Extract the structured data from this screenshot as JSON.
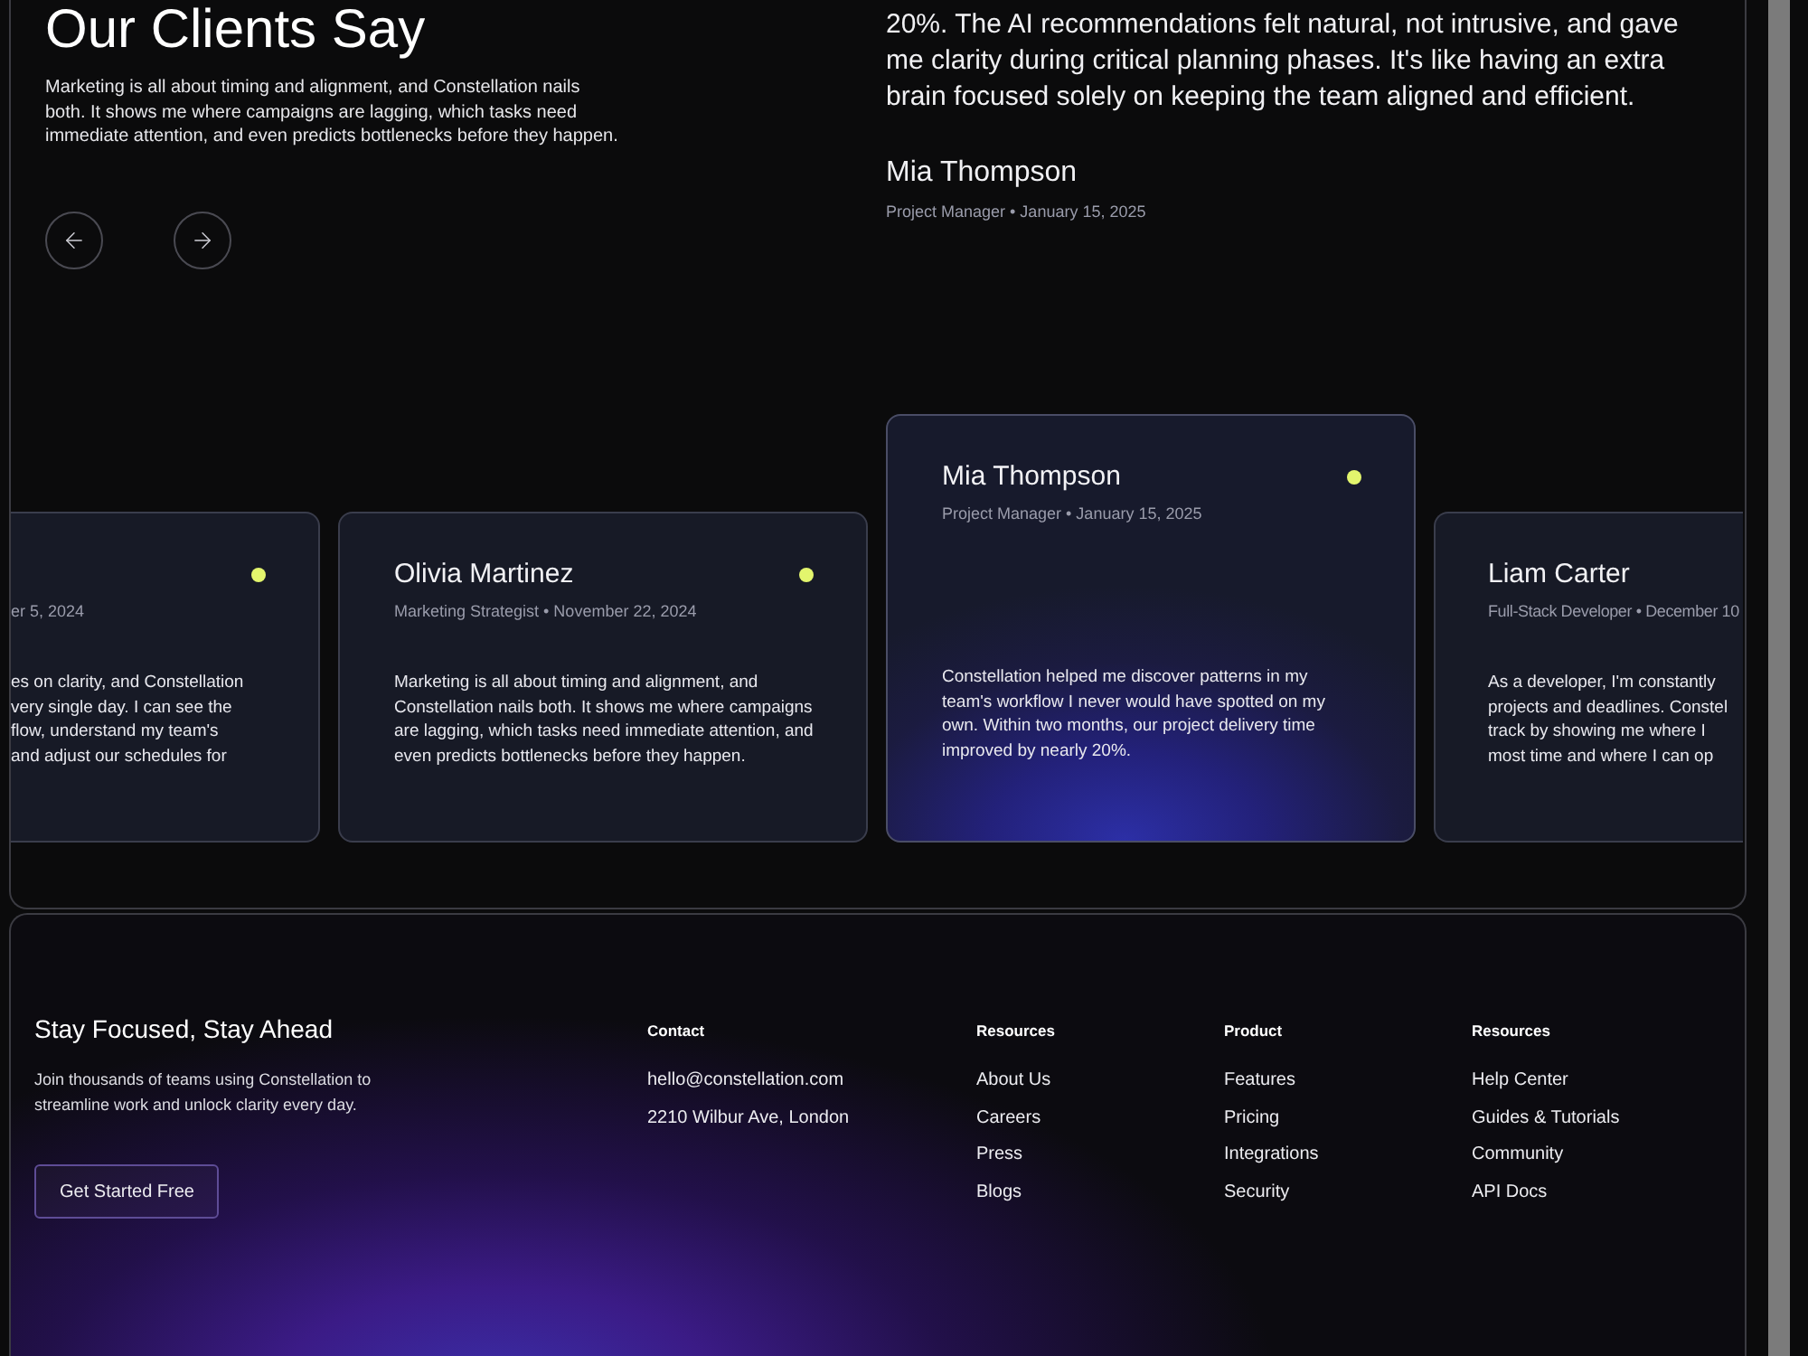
{
  "testimonials": {
    "heading": "Our Clients Say",
    "intro": "Marketing is all about timing and alignment, and Constellation nails both. It shows me where campaigns are lagging, which tasks need immediate attention, and even predicts bottlenecks before they happen."
  },
  "featured_quote": {
    "text": "20%. The AI recommendations felt natural, not intrusive, and gave me clarity during critical planning phases. It's like having an extra brain focused solely on keeping the team aligned and efficient.",
    "name": "Mia Thompson",
    "meta": "Project Manager • January 15, 2025"
  },
  "cards": [
    {
      "kind": "clipped_left",
      "selected": false,
      "meta": "er 5, 2024",
      "lines": [
        "es on clarity, and Constellation",
        "very single day. I can see the",
        "flow, understand my team's",
        "and adjust our schedules for"
      ]
    },
    {
      "kind": "full",
      "selected": false,
      "name": "Olivia Martinez",
      "meta": "Marketing Strategist • November 22, 2024",
      "text": "Marketing is all about timing and alignment, and Constellation nails both. It shows me where campaigns are lagging, which tasks need immediate attention, and even predicts bottlenecks before they happen."
    },
    {
      "kind": "full",
      "selected": true,
      "name": "Mia Thompson",
      "meta": "Project Manager • January 15, 2025",
      "text": "Constellation helped me discover patterns in my team's workflow I never would have spotted on my own. Within two months, our project delivery time improved by nearly 20%."
    },
    {
      "kind": "clipped_right",
      "selected": false,
      "name": "Liam Carter",
      "meta": "Full-Stack Developer • December 10",
      "lines": [
        "As a developer, I'm constantly",
        "projects and deadlines. Constel",
        "track by showing me where I",
        "most time and where I can op"
      ]
    }
  ],
  "footer": {
    "title": "Stay Focused, Stay Ahead",
    "text": "Join thousands of teams using Constellation to streamline work and unlock clarity every day.",
    "button": "Get Started Free",
    "columns": [
      {
        "heading": "Contact",
        "items": [
          "hello@constellation.com",
          "2210 Wilbur Ave, London"
        ]
      },
      {
        "heading": "Resources",
        "items": [
          "About Us",
          "Careers",
          "Press",
          "Blogs"
        ]
      },
      {
        "heading": "Product",
        "items": [
          "Features",
          "Pricing",
          "Integrations",
          "Security"
        ]
      },
      {
        "heading": "Resources",
        "items": [
          "Help Center",
          "Guides & Tutorials",
          "Community",
          "API Docs"
        ]
      }
    ]
  }
}
